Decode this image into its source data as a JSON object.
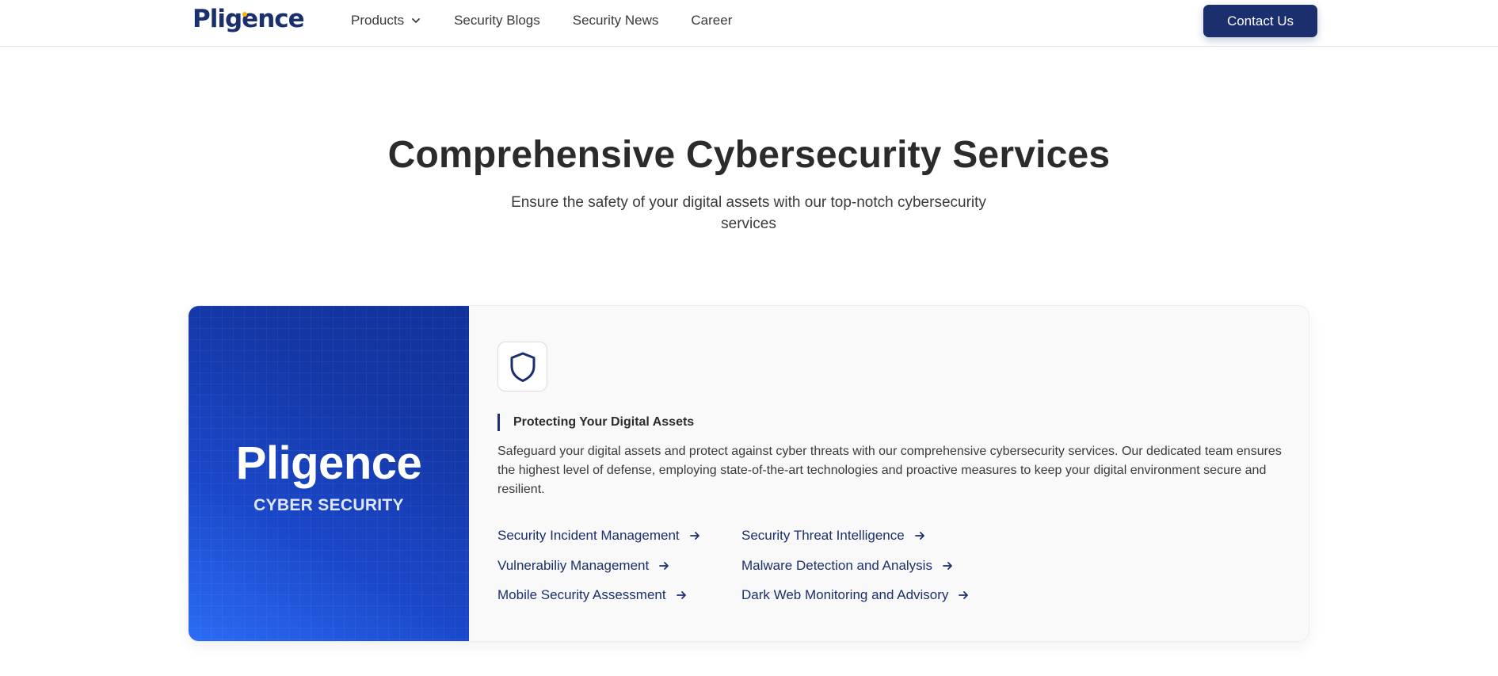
{
  "header": {
    "logo": "Pligence",
    "nav": [
      {
        "label": "Products",
        "has_dropdown": true
      },
      {
        "label": "Security Blogs"
      },
      {
        "label": "Security News"
      },
      {
        "label": "Career"
      }
    ],
    "contact_label": "Contact Us"
  },
  "hero": {
    "title": "Comprehensive Cybersecurity Services",
    "subtitle": "Ensure the safety of your digital assets with our top-notch cybersecurity services"
  },
  "card": {
    "brand_name": "Pligence",
    "brand_tag": "CYBER SECURITY",
    "icon": "shield-icon",
    "section_label": "Protecting Your Digital Assets",
    "description": "Safeguard your digital assets and protect against cyber threats with our comprehensive cybersecurity services. Our dedicated team ensures the highest level of defense, employing state-of-the-art technologies and proactive measures to keep your digital environment secure and resilient.",
    "links": [
      "Security Incident Management",
      "Vulnerabiliy Management",
      "Mobile Security Assessment",
      "Security Threat Intelligence",
      "Malware Detection and Analysis",
      "Dark Web Monitoring and Advisory"
    ]
  },
  "colors": {
    "brand_navy": "#1b2f6e",
    "brand_blue": "#1a47c9",
    "accent_yellow": "#f5b400"
  }
}
